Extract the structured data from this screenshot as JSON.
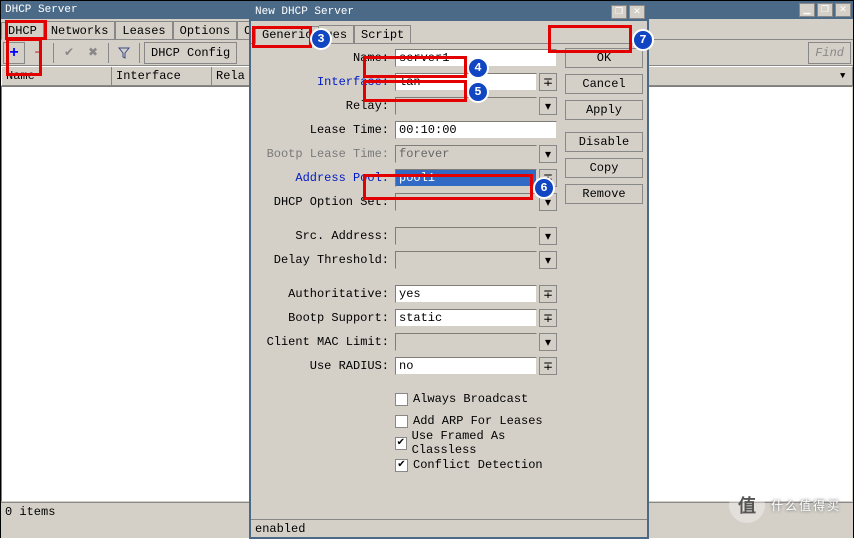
{
  "parent_window": {
    "title": "DHCP Server",
    "tabs": [
      "DHCP",
      "Networks",
      "Leases",
      "Options",
      "Option"
    ],
    "toolbar": {
      "dhcp_config": "DHCP Config",
      "find": "Find"
    },
    "columns": {
      "name": "Name",
      "interface": "Interface",
      "relay": "Rela"
    },
    "status": "0 items"
  },
  "dialog": {
    "title": "New DHCP Server",
    "tabs": {
      "generic": "Generic",
      "queues": "ues",
      "script": "Script"
    },
    "buttons": {
      "ok": "OK",
      "cancel": "Cancel",
      "apply": "Apply",
      "disable": "Disable",
      "copy": "Copy",
      "remove": "Remove"
    },
    "fields": {
      "name": {
        "label": "Name:",
        "value": "server1"
      },
      "interface": {
        "label": "Interface:",
        "value": "lan"
      },
      "relay": {
        "label": "Relay:",
        "value": ""
      },
      "lease_time": {
        "label": "Lease Time:",
        "value": "00:10:00"
      },
      "bootp_lease_time": {
        "label": "Bootp Lease Time:",
        "value": "forever"
      },
      "address_pool": {
        "label": "Address Pool:",
        "value": "pool1"
      },
      "dhcp_option_set": {
        "label": "DHCP Option Set:",
        "value": ""
      },
      "src_address": {
        "label": "Src. Address:",
        "value": ""
      },
      "delay_threshold": {
        "label": "Delay Threshold:",
        "value": ""
      },
      "authoritative": {
        "label": "Authoritative:",
        "value": "yes"
      },
      "bootp_support": {
        "label": "Bootp Support:",
        "value": "static"
      },
      "client_mac_limit": {
        "label": "Client MAC Limit:",
        "value": ""
      },
      "use_radius": {
        "label": "Use RADIUS:",
        "value": "no"
      }
    },
    "checks": {
      "always_broadcast": {
        "label": "Always Broadcast",
        "checked": false
      },
      "add_arp": {
        "label": "Add ARP For Leases",
        "checked": false
      },
      "use_framed": {
        "label": "Use Framed As Classless",
        "checked": true
      },
      "conflict": {
        "label": "Conflict Detection",
        "checked": true
      }
    },
    "status": "enabled"
  },
  "watermark": "什么值得买",
  "annotations": {
    "3": "3",
    "4": "4",
    "5": "5",
    "6": "6",
    "7": "7"
  }
}
